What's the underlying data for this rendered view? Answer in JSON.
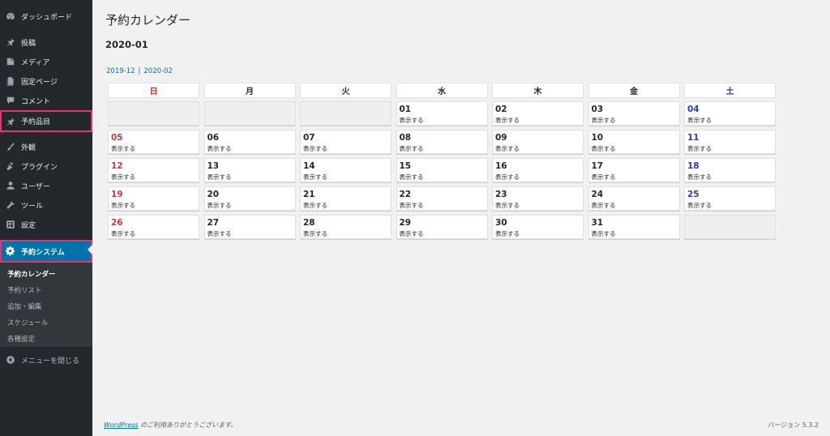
{
  "sidebar": {
    "items": [
      {
        "label": "ダッシュボード",
        "icon": "dashboard-icon"
      },
      {
        "label": "投稿",
        "icon": "pin-icon"
      },
      {
        "label": "メディア",
        "icon": "media-icon"
      },
      {
        "label": "固定ページ",
        "icon": "page-icon"
      },
      {
        "label": "コメント",
        "icon": "comment-icon"
      },
      {
        "label": "予約品目",
        "icon": "pin-icon"
      },
      {
        "label": "外観",
        "icon": "brush-icon"
      },
      {
        "label": "プラグイン",
        "icon": "plugin-icon"
      },
      {
        "label": "ユーザー",
        "icon": "user-icon"
      },
      {
        "label": "ツール",
        "icon": "wrench-icon"
      },
      {
        "label": "設定",
        "icon": "settings-icon"
      },
      {
        "label": "予約システム",
        "icon": "gear-icon"
      }
    ],
    "submenu": [
      "予約カレンダー",
      "予約リスト",
      "追加・編集",
      "スケジュール",
      "各種設定"
    ],
    "collapse_label": "メニューを閉じる"
  },
  "main": {
    "title": "予約カレンダー",
    "month": "2020-01",
    "prev_month": "2019-12",
    "separator": "|",
    "next_month": "2020-02"
  },
  "calendar": {
    "weekdays": [
      "日",
      "月",
      "火",
      "水",
      "木",
      "金",
      "土"
    ],
    "show_label": "表示する",
    "weeks": [
      [
        "",
        "",
        "",
        "01",
        "02",
        "03",
        "04"
      ],
      [
        "05",
        "06",
        "07",
        "08",
        "09",
        "10",
        "11"
      ],
      [
        "12",
        "13",
        "14",
        "15",
        "16",
        "17",
        "18"
      ],
      [
        "19",
        "20",
        "21",
        "22",
        "23",
        "24",
        "25"
      ],
      [
        "26",
        "27",
        "28",
        "29",
        "30",
        "31",
        ""
      ]
    ]
  },
  "footer": {
    "link": "WordPress",
    "thanks": " のご利用ありがとうございます。",
    "version": "バージョン 5.3.2"
  },
  "colors": {
    "sidebar_bg": "#23282d",
    "active_bg": "#0073aa",
    "highlight_border": "#e8336e",
    "sunday": "#d63638",
    "saturday": "#2c3db9"
  }
}
